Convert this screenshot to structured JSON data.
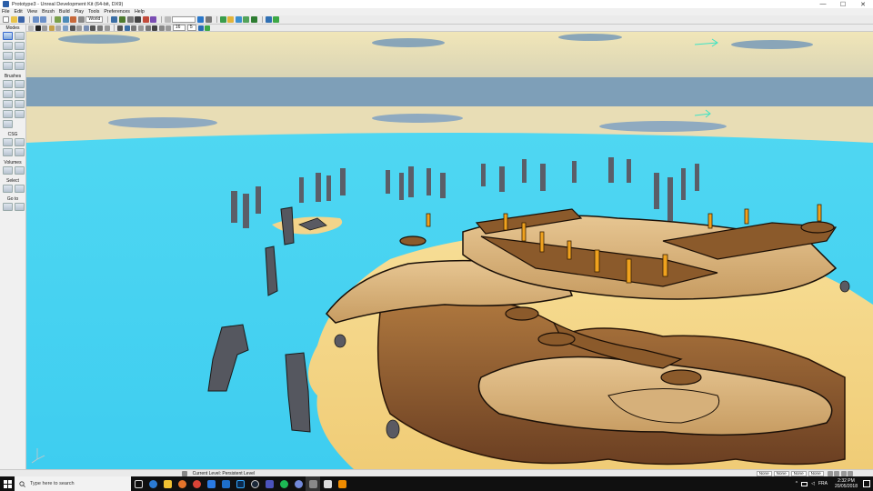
{
  "window": {
    "title": "Prototype3 - Unreal Development Kit (64-bit, DX9)",
    "controls": {
      "minimize": "—",
      "maximize": "☐",
      "close": "✕"
    }
  },
  "menu": [
    "File",
    "Edit",
    "View",
    "Brush",
    "Build",
    "Play",
    "Tools",
    "Preferences",
    "Help"
  ],
  "toolbar": {
    "coord_system": "World",
    "grid_value": "16",
    "angle_value": "5"
  },
  "modes_panel": {
    "title": "Modes",
    "sections": [
      "Brushes",
      "CSG",
      "Volumes",
      "Select",
      "Go to"
    ]
  },
  "status": {
    "current_level": "Current Level:  Persistent Level",
    "fields": [
      "None",
      "None",
      "None",
      "None"
    ]
  },
  "taskbar": {
    "search_placeholder": "Type here to search",
    "language": "FRA",
    "time": "2:32 PM",
    "date": "20/05/2018"
  },
  "colors": {
    "sea": "#4fd7f2",
    "sand": "#f3d48a",
    "sky_band": "#7e9fb8",
    "rock": "#8a5a34"
  }
}
